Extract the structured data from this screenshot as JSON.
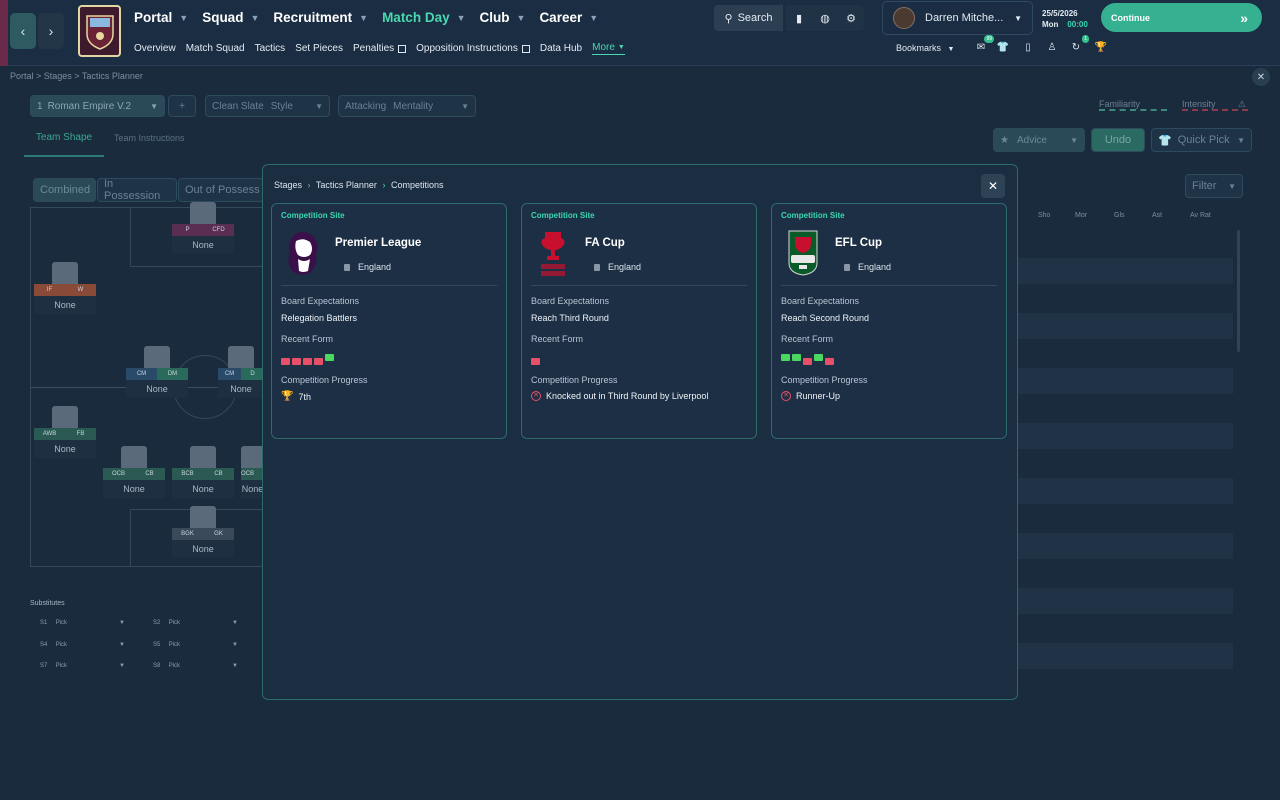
{
  "topbar": {
    "nav": [
      {
        "label": "Portal",
        "active": false
      },
      {
        "label": "Squad",
        "active": false
      },
      {
        "label": "Recruitment",
        "active": false
      },
      {
        "label": "Match Day",
        "active": true
      },
      {
        "label": "Club",
        "active": false
      },
      {
        "label": "Career",
        "active": false
      }
    ],
    "subnav": [
      {
        "label": "Overview",
        "external": false
      },
      {
        "label": "Match Squad",
        "external": false
      },
      {
        "label": "Tactics",
        "external": false
      },
      {
        "label": "Set Pieces",
        "external": false
      },
      {
        "label": "Penalties",
        "external": true
      },
      {
        "label": "Opposition Instructions",
        "external": true
      },
      {
        "label": "Data Hub",
        "external": false
      },
      {
        "label": "More",
        "external": false
      }
    ],
    "search_label": "Search",
    "user_name": "Darren Mitche...",
    "date": "25/5/2026",
    "day": "Mon",
    "time": "00:00",
    "continue_label": "Continue",
    "bookmarks_label": "Bookmarks",
    "inbox_badge": "99",
    "news_badge": "1"
  },
  "page": {
    "breadcrumb": "Portal > Stages > Tactics Planner",
    "tactic_slot": "1",
    "tactic_name": "Roman Empire V.2",
    "add_label": "+",
    "style_value": "Clean Slate",
    "style_label": "Style",
    "mentality_value": "Attacking",
    "mentality_label": "Mentality",
    "familiarity_label": "Familiarity",
    "intensity_label": "Intensity",
    "tab_team_shape": "Team Shape",
    "tab_team_instructions": "Team Instructions",
    "advice_label": "Advice",
    "undo_label": "Undo",
    "quick_pick_label": "Quick Pick",
    "view_combined": "Combined",
    "view_in_possession": "In Possession",
    "view_out_possession": "Out of Possess",
    "filter_label": "Filter",
    "stat_headers": [
      "Sho",
      "Mor",
      "Gls",
      "Ast",
      "Av Rat"
    ],
    "subs_title": "Substitutes",
    "subs": [
      {
        "slot": "S1",
        "value": "Pick"
      },
      {
        "slot": "S2",
        "value": "Pick"
      },
      {
        "slot": "S4",
        "value": "Pick"
      },
      {
        "slot": "S5",
        "value": "Pick"
      },
      {
        "slot": "S7",
        "value": "Pick"
      },
      {
        "slot": "S8",
        "value": "Pick"
      }
    ],
    "players": [
      {
        "r1": "P",
        "r2": "CFD",
        "name": "None"
      },
      {
        "r1": "IF",
        "r2": "W",
        "name": "None"
      },
      {
        "r1": "CM",
        "r2": "DM",
        "name": "None"
      },
      {
        "r1": "CM",
        "r2": "D",
        "name": "None"
      },
      {
        "r1": "AWB",
        "r2": "FB",
        "name": "None"
      },
      {
        "r1": "OCB",
        "r2": "CB",
        "name": "None"
      },
      {
        "r1": "BCB",
        "r2": "CB",
        "name": "None"
      },
      {
        "r1": "OCB",
        "r2": "",
        "name": "None"
      },
      {
        "r1": "BGK",
        "r2": "GK",
        "name": "None"
      }
    ]
  },
  "modal": {
    "breadcrumb_1": "Stages",
    "breadcrumb_2": "Tactics Planner",
    "breadcrumb_3": "Competitions",
    "cards": [
      {
        "site_label": "Competition Site",
        "name": "Premier League",
        "nation": "England",
        "board_label": "Board Expectations",
        "board_value": "Relegation Battlers",
        "form_label": "Recent Form",
        "form": [
          "L",
          "L",
          "L",
          "L",
          "W"
        ],
        "progress_label": "Competition Progress",
        "progress_value": "7th",
        "progress_icon": "trophy-icon"
      },
      {
        "site_label": "Competition Site",
        "name": "FA Cup",
        "nation": "England",
        "board_label": "Board Expectations",
        "board_value": "Reach Third Round",
        "form_label": "Recent Form",
        "form": [
          "L"
        ],
        "progress_label": "Competition Progress",
        "progress_value": "Knocked out in Third Round by Liverpool",
        "progress_icon": "cross-circle-icon"
      },
      {
        "site_label": "Competition Site",
        "name": "EFL Cup",
        "nation": "England",
        "board_label": "Board Expectations",
        "board_value": "Reach Second Round",
        "form_label": "Recent Form",
        "form": [
          "W",
          "W",
          "L",
          "W",
          "L"
        ],
        "progress_label": "Competition Progress",
        "progress_value": "Runner-Up",
        "progress_icon": "cross-circle-icon"
      }
    ]
  },
  "colors": {
    "accent": "#35b090",
    "win": "#4ad860",
    "loss": "#e8506a"
  }
}
